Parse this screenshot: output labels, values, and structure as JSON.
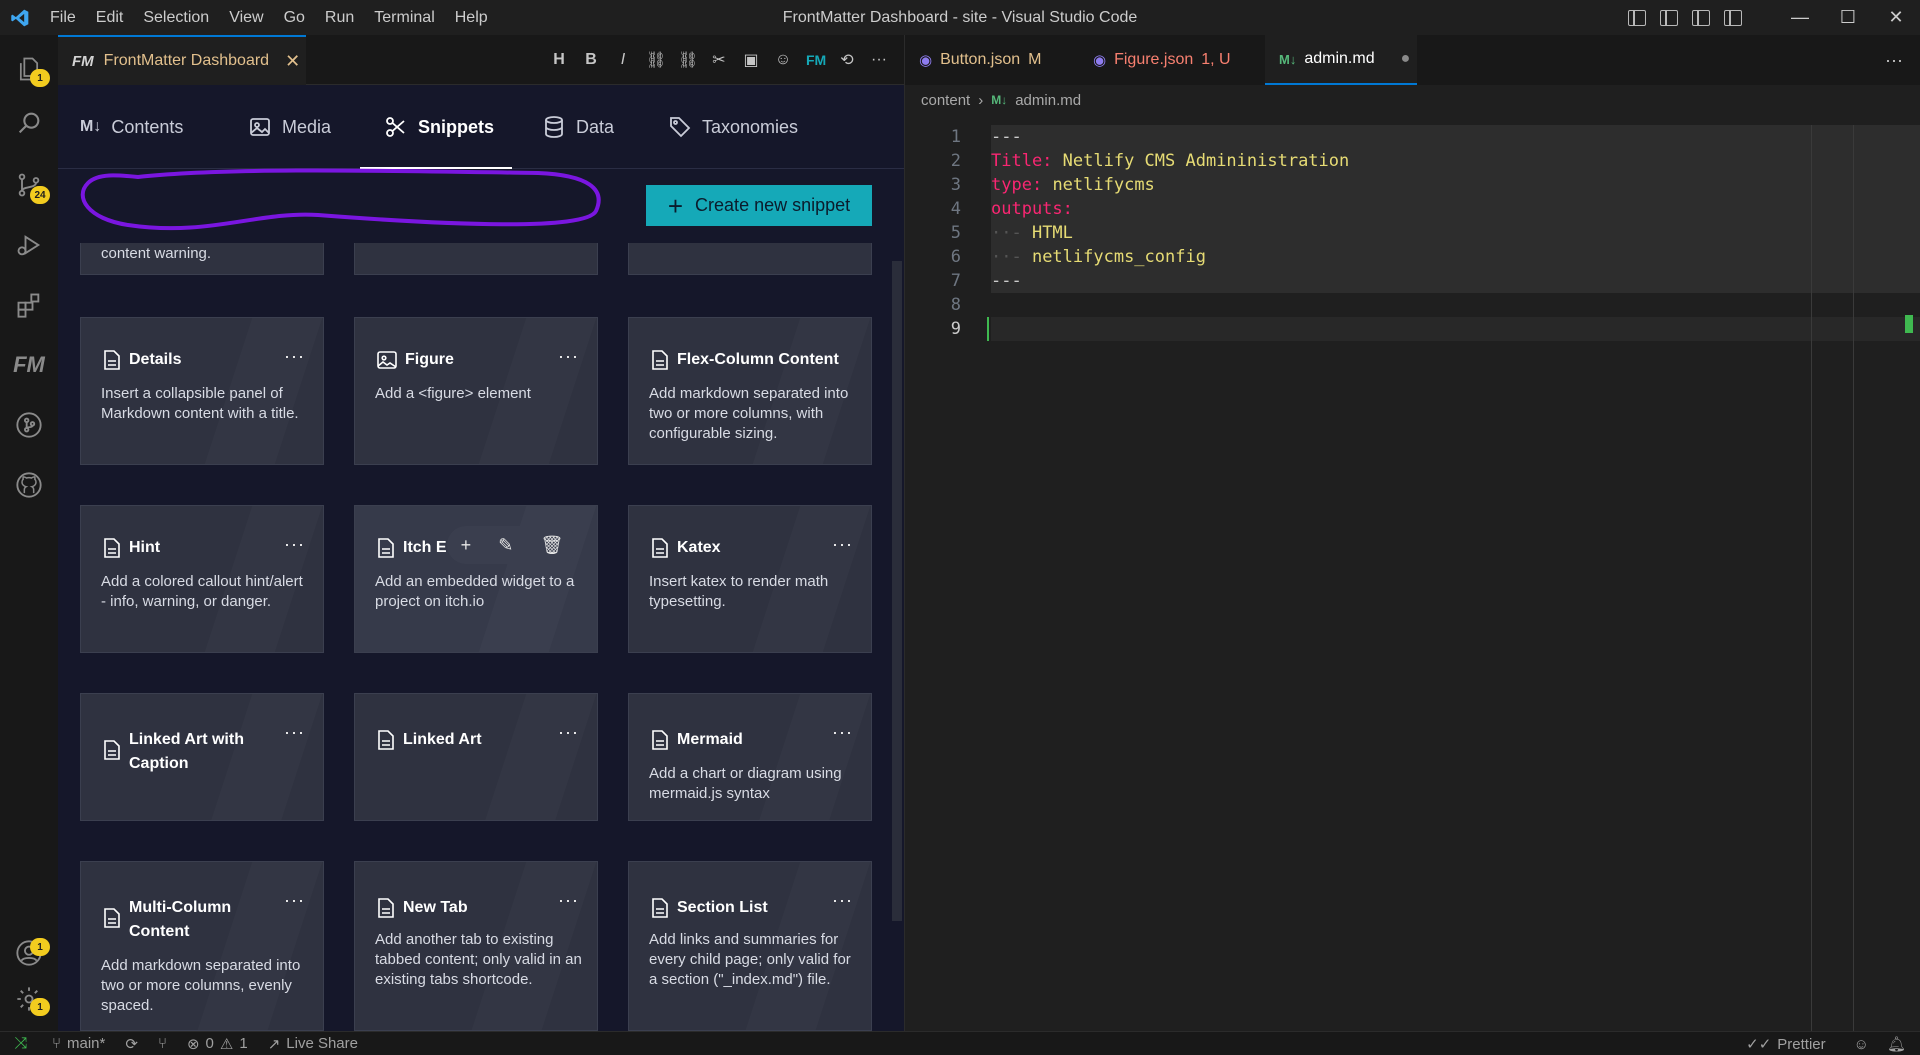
{
  "window": {
    "title": "FrontMatter Dashboard - site - Visual Studio Code",
    "menu": [
      "File",
      "Edit",
      "Selection",
      "View",
      "Go",
      "Run",
      "Terminal",
      "Help"
    ]
  },
  "activity_bar": {
    "explorer_badge": "1",
    "scm_badge": "24",
    "accounts_badge": "1",
    "settings_badge": "1"
  },
  "left_tab": {
    "label": "FrontMatter Dashboard",
    "logo_text": "FM"
  },
  "dashboard": {
    "tabs": [
      {
        "label": "Contents",
        "icon": "markdown-icon"
      },
      {
        "label": "Media",
        "icon": "image-icon"
      },
      {
        "label": "Snippets",
        "icon": "scissors-icon"
      },
      {
        "label": "Data",
        "icon": "database-icon"
      },
      {
        "label": "Taxonomies",
        "icon": "tag-icon"
      }
    ],
    "active_tab": "Snippets",
    "create_button": "Create new snippet",
    "partial_card_text": "content warning.",
    "cards": [
      {
        "title": "Details",
        "desc": "Insert a collapsible panel of Markdown content with a title."
      },
      {
        "title": "Figure",
        "desc": "Add a <figure> element"
      },
      {
        "title": "Flex-Column Content",
        "desc": "Add markdown separated into two or more columns, with configurable sizing."
      },
      {
        "title": "Hint",
        "desc": "Add a colored callout hint/alert - info, warning, or danger."
      },
      {
        "title": "Itch E",
        "desc": "Add an embedded widget to a project on itch.io"
      },
      {
        "title": "Katex",
        "desc": "Insert katex to render math typesetting."
      },
      {
        "title": "Linked Art with Caption",
        "desc": ""
      },
      {
        "title": "Linked Art",
        "desc": ""
      },
      {
        "title": "Mermaid",
        "desc": "Add a chart or diagram using mermaid.js syntax"
      },
      {
        "title": "Multi-Column Content",
        "desc": "Add markdown separated into two or more columns, evenly spaced."
      },
      {
        "title": "New Tab",
        "desc": "Add another tab to existing tabbed content; only valid in an existing tabs shortcode."
      },
      {
        "title": "Section List",
        "desc": "Add links and summaries for every child page; only valid for a section (\"_index.md\") file."
      }
    ],
    "card_menu": "···"
  },
  "right_tabs": [
    {
      "label": "Button.json",
      "status": "M",
      "color": "#e2c08d"
    },
    {
      "label": "Figure.json",
      "status": "1, U",
      "color": "#f88070"
    },
    {
      "label": "admin.md",
      "status": "●",
      "color": "#cccccc"
    }
  ],
  "breadcrumb": {
    "folder": "content",
    "file": "admin.md"
  },
  "code": {
    "lines": [
      {
        "n": "1",
        "key": "---",
        "val": ""
      },
      {
        "n": "2",
        "key": "Title:",
        "val": "Netlify CMS Admininistration"
      },
      {
        "n": "3",
        "key": "type:",
        "val": "netlifycms"
      },
      {
        "n": "4",
        "key": "outputs:",
        "val": ""
      },
      {
        "n": "5",
        "key": "··- ",
        "val": "HTML"
      },
      {
        "n": "6",
        "key": "··- ",
        "val": "netlifycms_config"
      },
      {
        "n": "7",
        "key": "---",
        "val": ""
      },
      {
        "n": "8",
        "key": "",
        "val": ""
      },
      {
        "n": "9",
        "key": "",
        "val": ""
      }
    ]
  },
  "status_bar": {
    "branch": "main*",
    "errors": "0",
    "warnings": "1",
    "live_share": "Live Share",
    "formatter": "Prettier"
  }
}
